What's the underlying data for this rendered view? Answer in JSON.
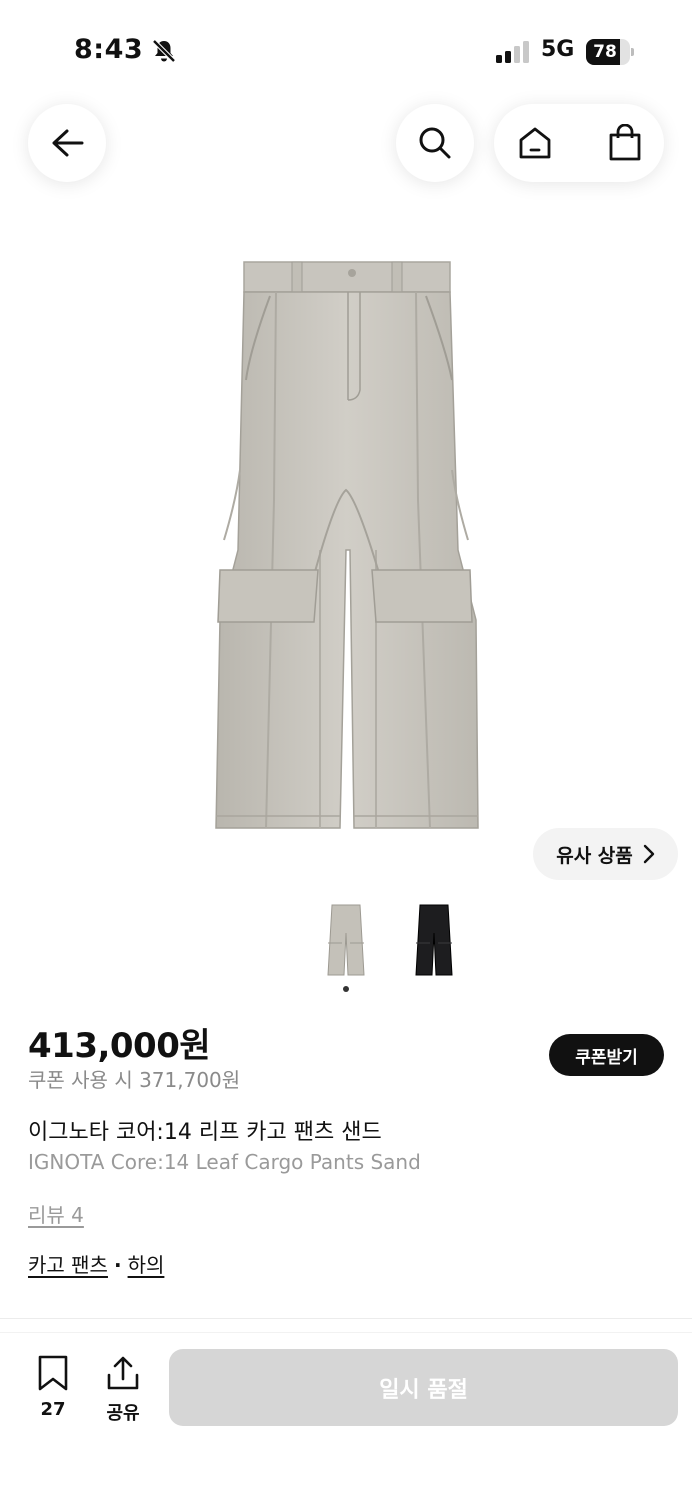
{
  "status_bar": {
    "time": "8:43",
    "network": "5G",
    "battery_percent": "78",
    "battery_level": 0.78
  },
  "nav": {
    "icons": [
      "back-arrow-icon",
      "search-icon",
      "home-icon",
      "shopping-bag-icon"
    ]
  },
  "gallery": {
    "similar_label": "유사 상품",
    "thumbnail_colors": [
      "sand",
      "black"
    ],
    "current_index": 1,
    "count": 2
  },
  "product": {
    "price": "413,000원",
    "coupon_price": "쿠폰 사용 시 371,700원",
    "coupon_button": "쿠폰받기",
    "title_ko": "이그노타 코어:14 리프 카고 팬츠 샌드",
    "title_en": "IGNOTA Core:14 Leaf Cargo Pants Sand",
    "review": "리뷰 4",
    "category": "카고 팬츠",
    "category_parent": "하의"
  },
  "bottom_bar": {
    "bookmark_count": "27",
    "share_label": "공유",
    "soldout_label": "일시 품절"
  }
}
